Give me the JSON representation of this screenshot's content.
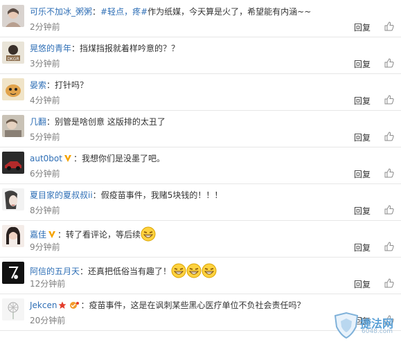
{
  "comments": [
    {
      "username": "可乐不加冰_粥粥",
      "hashtag": "#轻点，疼#",
      "text": "作为纸媒，今天算是火了，希望能有内涵~~",
      "time": "2分钟前",
      "reply": "回复",
      "badge": "",
      "emoji_count": 0
    },
    {
      "username": "晃悠的青年",
      "hashtag": "",
      "text": "挡煤挡报就着样吟意的？？",
      "time": "3分钟前",
      "reply": "回复",
      "badge": "",
      "emoji_count": 0
    },
    {
      "username": "晏索",
      "hashtag": "",
      "text": "打针吗？",
      "time": "4分钟前",
      "reply": "回复",
      "badge": "",
      "emoji_count": 0
    },
    {
      "username": "几翻",
      "hashtag": "",
      "text": "别管是啥创意 这版排的太丑了",
      "time": "5分钟前",
      "reply": "回复",
      "badge": "",
      "emoji_count": 0
    },
    {
      "username": "aut0bot",
      "hashtag": "",
      "text": "我想你们是没墨了吧。",
      "time": "6分钟前",
      "reply": "回复",
      "badge": "v-badge",
      "emoji_count": 0
    },
    {
      "username": "夏目家的夏叔叔ii",
      "hashtag": "",
      "text": "假疫苗事件，我赌5块钱的！！！",
      "time": "8分钟前",
      "reply": "回复",
      "badge": "",
      "emoji_count": 0
    },
    {
      "username": "嘉佳",
      "hashtag": "",
      "text": "转了看评论，等后续",
      "time": "9分钟前",
      "reply": "回复",
      "badge": "v-badge",
      "emoji_count": 1
    },
    {
      "username": "阿信的五月天",
      "hashtag": "",
      "text": "还真把低俗当有趣了！",
      "time": "12分钟前",
      "reply": "回复",
      "badge": "",
      "emoji_count": 3
    },
    {
      "username": "Jekcen",
      "hashtag": "",
      "text": "疫苗事件，这是在讽刺某些黑心医疗单位不负社会责任吗？",
      "time": "20分钟前",
      "reply": "回复",
      "badge": "star-member",
      "emoji_count": 0
    }
  ],
  "watermark": {
    "brand": "捷法网",
    "url": "6048.com"
  },
  "colors": {
    "username": "#2f6fb6",
    "text": "#333333",
    "time": "#808080",
    "divider": "#e6e6e6",
    "badge": "#f5a300"
  },
  "icons": {
    "like": "thumbs-up-icon",
    "verified": "v-badge-icon",
    "member": "star-icon",
    "emoji": "laughing-face-icon"
  }
}
